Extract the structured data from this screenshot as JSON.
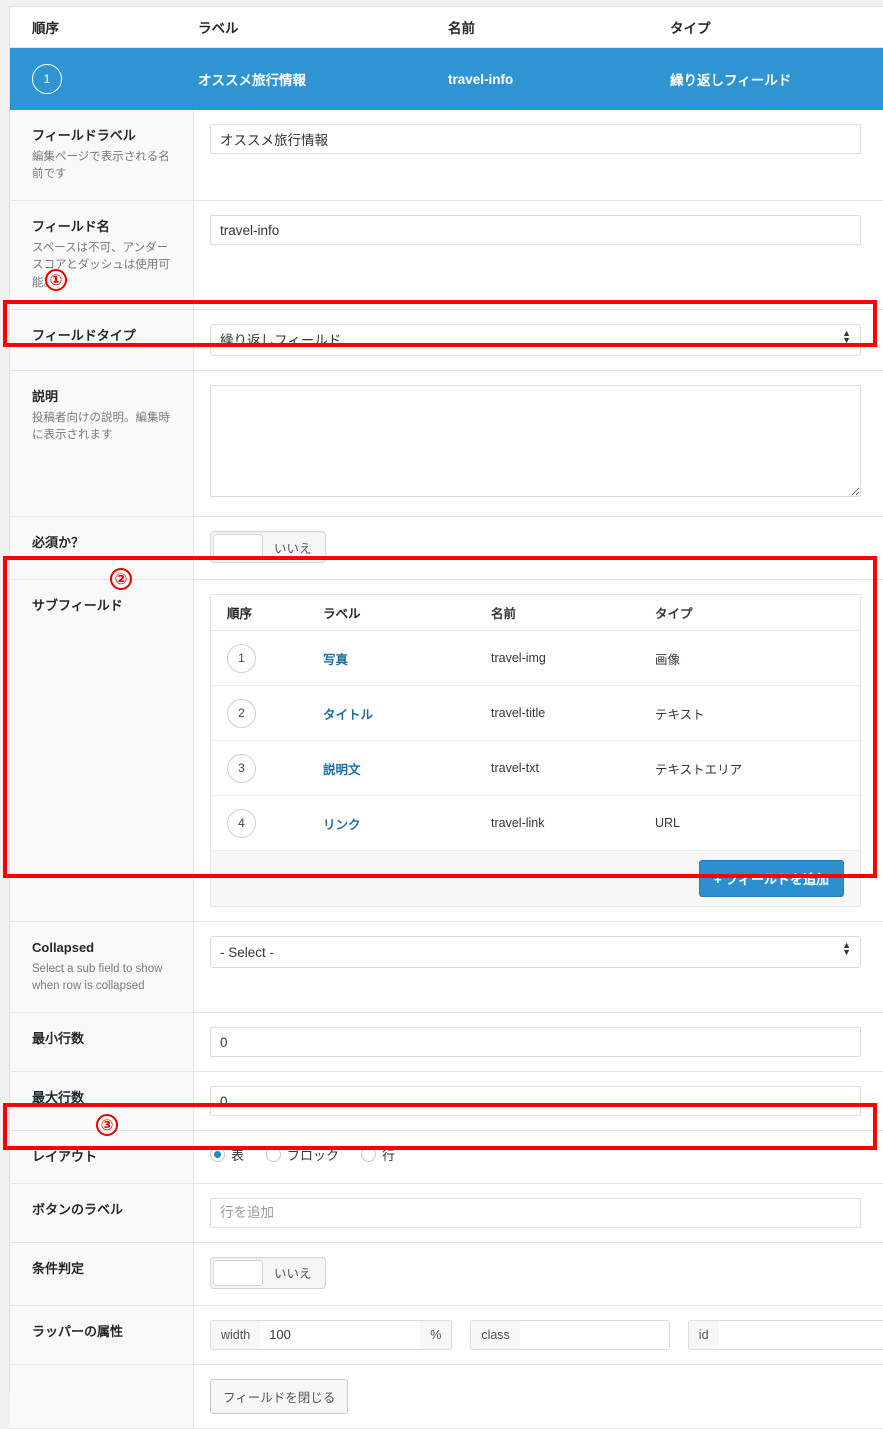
{
  "field_list": {
    "headers": [
      "順序",
      "ラベル",
      "名前",
      "タイプ"
    ],
    "active_row": {
      "order": "1",
      "label": "オススメ旅行情報",
      "name": "travel-info",
      "type": "繰り返しフィールド"
    }
  },
  "settings": {
    "field_label": {
      "label": "フィールドラベル",
      "desc": "編集ページで表示される名前です",
      "value": "オススメ旅行情報"
    },
    "field_name": {
      "label": "フィールド名",
      "desc": "スペースは不可、アンダースコアとダッシュは使用可能。",
      "value": "travel-info"
    },
    "field_type": {
      "label": "フィールドタイプ",
      "value": "繰り返しフィールド"
    },
    "instructions": {
      "label": "説明",
      "desc": "投稿者向けの説明。編集時に表示されます",
      "value": ""
    },
    "required": {
      "label": "必須か？",
      "state": "いいえ"
    },
    "sub_fields": {
      "label": "サブフィールド",
      "headers": [
        "順序",
        "ラベル",
        "名前",
        "タイプ"
      ],
      "rows": [
        {
          "order": "1",
          "label": "写真",
          "name": "travel-img",
          "type": "画像"
        },
        {
          "order": "2",
          "label": "タイトル",
          "name": "travel-title",
          "type": "テキスト"
        },
        {
          "order": "3",
          "label": "説明文",
          "name": "travel-txt",
          "type": "テキストエリア"
        },
        {
          "order": "4",
          "label": "リンク",
          "name": "travel-link",
          "type": "URL"
        }
      ],
      "add_button": "+ フィールドを追加"
    },
    "collapsed": {
      "label": "Collapsed",
      "desc": "Select a sub field to show when row is collapsed",
      "value": "- Select -"
    },
    "min_rows": {
      "label": "最小行数",
      "value": "0"
    },
    "max_rows": {
      "label": "最大行数",
      "value": "0"
    },
    "layout": {
      "label": "レイアウト",
      "options": [
        "表",
        "ブロック",
        "行"
      ],
      "selected": "表"
    },
    "button_label": {
      "label": "ボタンのラベル",
      "placeholder": "行を追加",
      "value": ""
    },
    "conditional": {
      "label": "条件判定",
      "state": "いいえ"
    },
    "wrapper": {
      "label": "ラッパーの属性",
      "width_addon": "width",
      "width_value": "100",
      "percent_addon": "%",
      "class_addon": "class",
      "class_value": "",
      "id_addon": "id",
      "id_value": ""
    },
    "close_button": "フィールドを閉じる"
  },
  "annotations": {
    "marker_1": "①",
    "marker_2": "②",
    "marker_3": "③",
    "color": "#ff0000"
  }
}
